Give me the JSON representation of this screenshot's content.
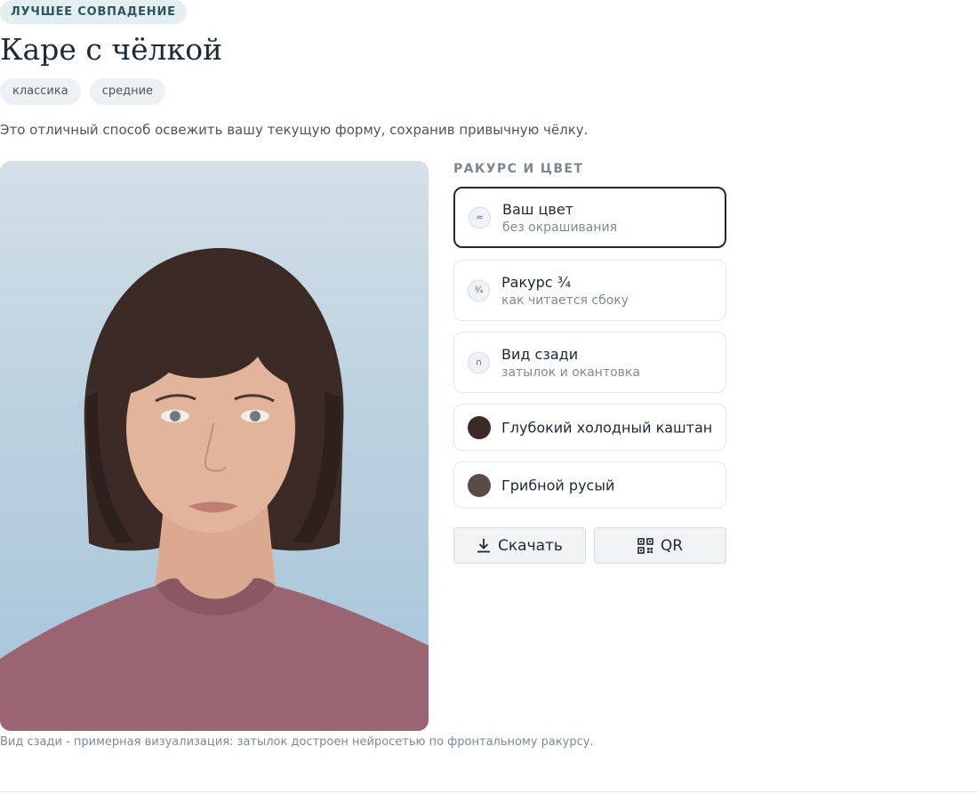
{
  "header": {
    "badge": "ЛУЧШЕЕ СОВПАДЕНИЕ",
    "title": "Каре с чёлкой",
    "tags": [
      "классика",
      "средние"
    ],
    "description": "Это отличный способ освежить вашу текущую форму, сохранив привычную чёлку."
  },
  "panel": {
    "heading": "РАКУРС И ЦВЕТ",
    "options": [
      {
        "icon": "approx-icon",
        "glyph": "≈",
        "label": "Ваш цвет",
        "sublabel": "без окрашивания",
        "selected": true
      },
      {
        "icon": "three-quarter-icon",
        "glyph": "¾",
        "label": "Ракурс ¾",
        "sublabel": "как читается сбоку",
        "selected": false
      },
      {
        "icon": "arch-icon",
        "glyph": "∩",
        "label": "Вид сзади",
        "sublabel": "затылок и окантовка",
        "selected": false
      }
    ],
    "colors": [
      {
        "label": "Глубокий холодный каштан",
        "swatch": "#3a2b29"
      },
      {
        "label": "Грибной русый",
        "swatch": "#5a4b48"
      }
    ],
    "buttons": {
      "download": "Скачать",
      "qr": "QR"
    }
  },
  "caption": "Вид сзади - примерная визуализация: затылок достроен нейросетью по фронтальному ракурсу.",
  "palette": {
    "accent_dark": "#1f2a33",
    "badge_bg": "#e3eef1",
    "hair": "#3b2a26",
    "shirt": "#9a6570",
    "skin": "#e3b49c"
  }
}
